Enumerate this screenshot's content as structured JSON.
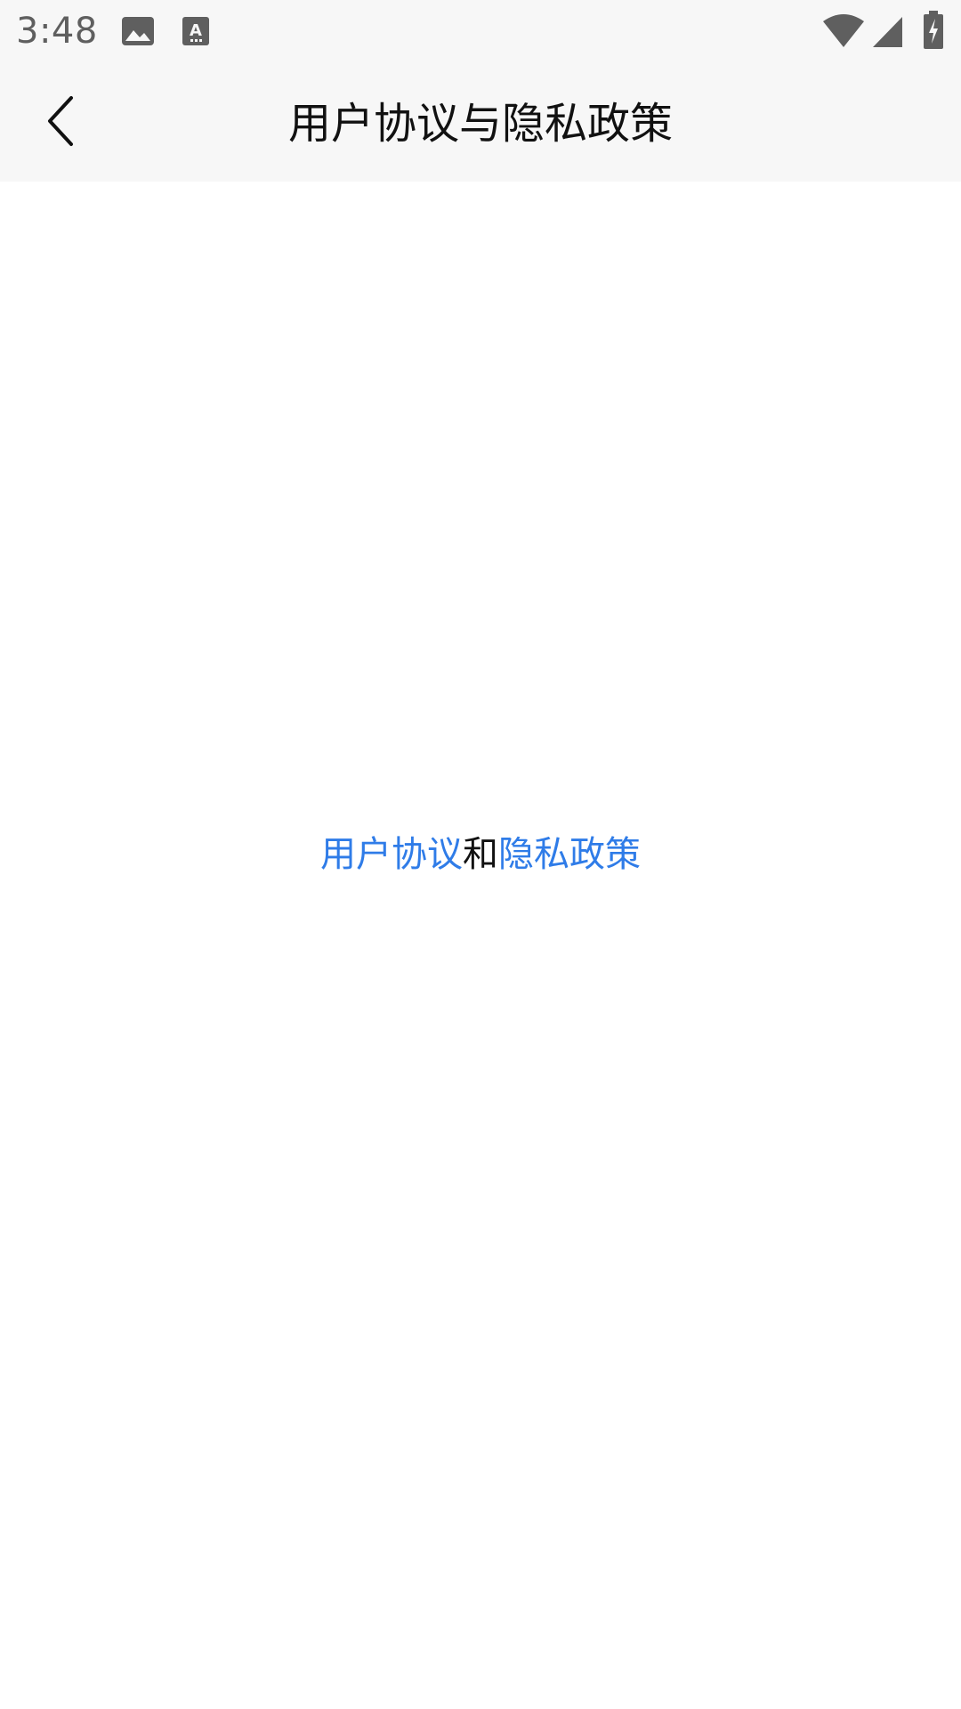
{
  "status_bar": {
    "time": "3:48",
    "icons": [
      "image-icon",
      "font-badge-icon",
      "wifi-icon",
      "cell-signal-icon",
      "battery-charging-icon"
    ]
  },
  "app_bar": {
    "title": "用户协议与隐私政策",
    "back_icon": "chevron-left-icon"
  },
  "content": {
    "user_agreement_link": "用户协议",
    "conjunction": "和",
    "privacy_policy_link": "隐私政策"
  },
  "colors": {
    "bar_background": "#f7f7f7",
    "link": "#2f7ce8",
    "text": "#111111",
    "status_icon": "#5f5f5f"
  }
}
